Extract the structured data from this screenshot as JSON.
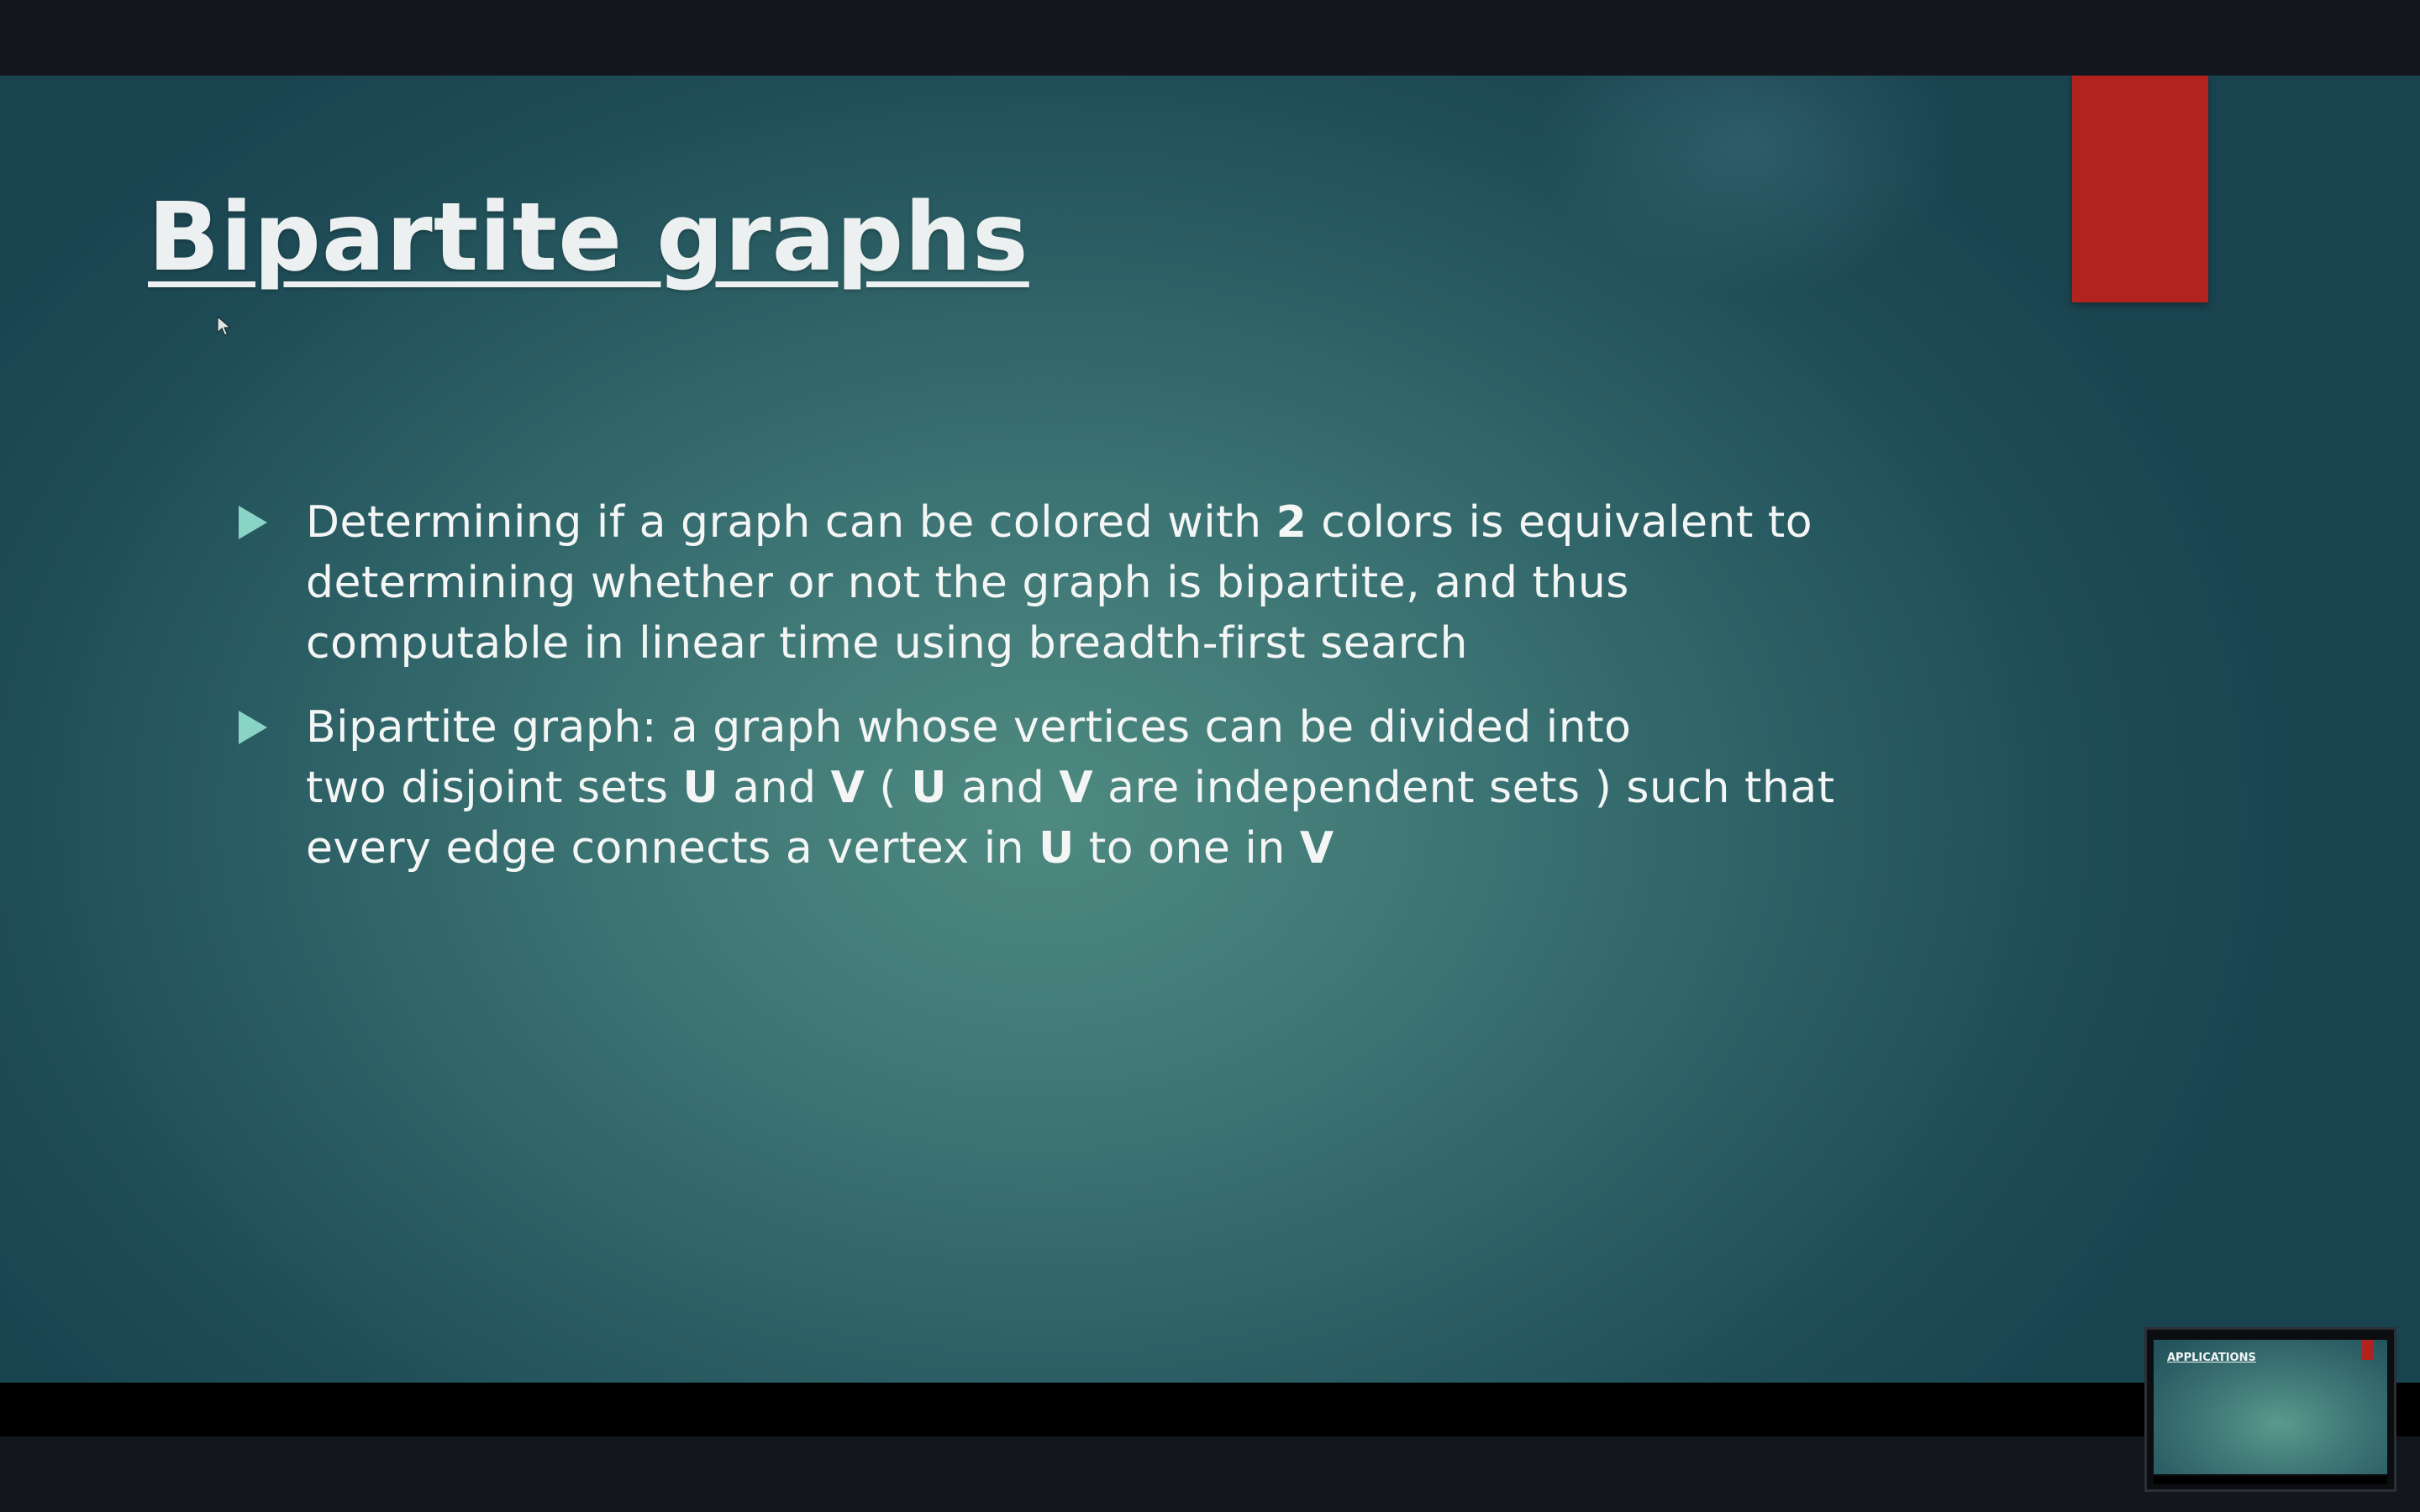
{
  "slide": {
    "title": "Bipartite graphs",
    "bullets": [
      {
        "lines": [
          [
            {
              "text": "Determining if a graph can be colored with ",
              "bold": false
            },
            {
              "text": "2",
              "bold": true
            },
            {
              "text": " colors is equivalent to",
              "bold": false
            }
          ],
          [
            {
              "text": "determining whether or not the graph is bipartite, and thus",
              "bold": false
            }
          ],
          [
            {
              "text": "computable in linear time using breadth-first search",
              "bold": false
            }
          ]
        ]
      },
      {
        "lines": [
          [
            {
              "text": "Bipartite graph: a graph whose vertices can be divided into",
              "bold": false
            }
          ],
          [
            {
              "text": "two disjoint sets ",
              "bold": false
            },
            {
              "text": "U",
              "bold": true
            },
            {
              "text": " and ",
              "bold": false
            },
            {
              "text": "V",
              "bold": true
            },
            {
              "text": " ( ",
              "bold": false
            },
            {
              "text": "U",
              "bold": true
            },
            {
              "text": " and ",
              "bold": false
            },
            {
              "text": "V",
              "bold": true
            },
            {
              "text": " are independent sets ) such that",
              "bold": false
            }
          ],
          [
            {
              "text": "every edge connects a vertex in ",
              "bold": false
            },
            {
              "text": "U",
              "bold": true
            },
            {
              "text": " to one in ",
              "bold": false
            },
            {
              "text": "V",
              "bold": true
            }
          ]
        ]
      }
    ]
  },
  "next_slide_preview": {
    "title": "APPLICATIONS"
  },
  "colors": {
    "accent": "#b2221e",
    "bullet_marker": "#8ad3c7",
    "text": "#f3f6f5",
    "background_center": "#4e8a80",
    "background_edge": "#1a4350"
  },
  "icons": {
    "bullet": "triangle-right-icon",
    "cursor": "mouse-pointer-icon"
  }
}
